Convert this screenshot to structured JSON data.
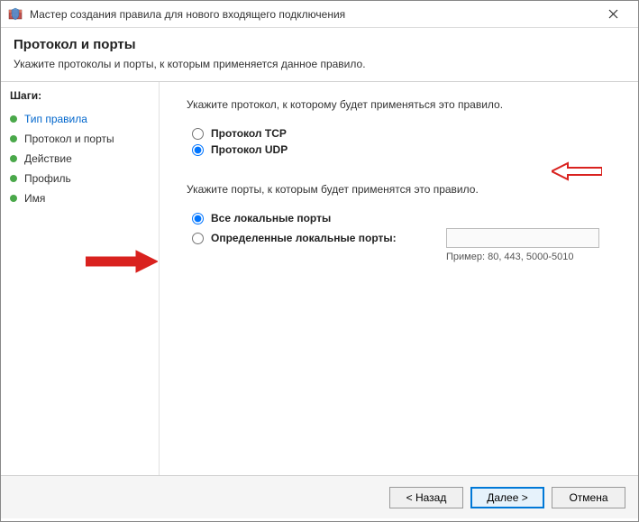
{
  "window": {
    "title": "Мастер создания правила для нового входящего подключения"
  },
  "header": {
    "title": "Протокол и порты",
    "subtitle": "Укажите протоколы и порты, к которым применяется данное правило."
  },
  "sidebar": {
    "title": "Шаги:",
    "steps": [
      {
        "label": "Тип правила",
        "active": true
      },
      {
        "label": "Протокол и порты",
        "active": false
      },
      {
        "label": "Действие",
        "active": false
      },
      {
        "label": "Профиль",
        "active": false
      },
      {
        "label": "Имя",
        "active": false
      }
    ]
  },
  "main": {
    "protocol_instruction": "Укажите протокол, к которому будет применяться это правило.",
    "protocol_tcp": "Протокол TCP",
    "protocol_udp": "Протокол UDP",
    "protocol_selected": "udp",
    "ports_instruction": "Укажите порты, к которым будет применятся это правило.",
    "ports_all": "Все локальные порты",
    "ports_specific": "Определенные локальные порты:",
    "ports_selected": "all",
    "ports_input_value": "",
    "ports_example": "Пример: 80, 443, 5000-5010"
  },
  "footer": {
    "back": "< Назад",
    "next": "Далее >",
    "cancel": "Отмена"
  }
}
